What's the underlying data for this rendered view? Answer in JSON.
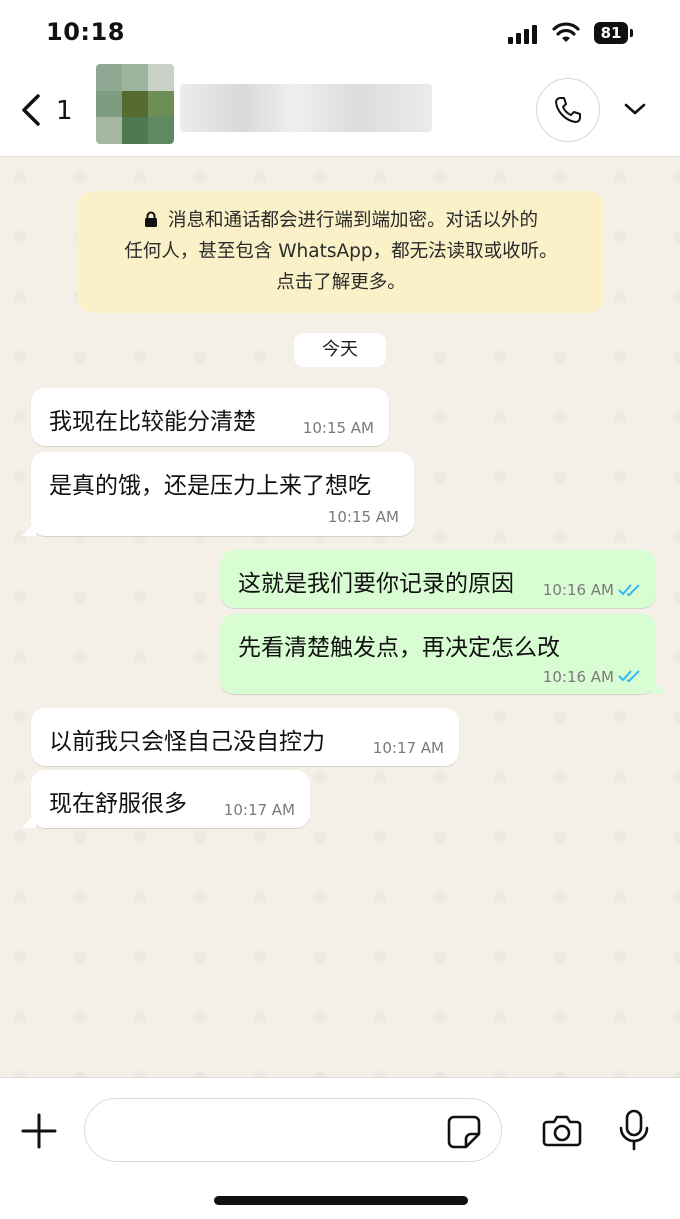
{
  "status_bar": {
    "time": "10:18",
    "battery": "81"
  },
  "header": {
    "back_count": "1"
  },
  "chat": {
    "encryption_notice": {
      "line1": "消息和通话都会进行端到端加密。对话以外的",
      "line2": "任何人，甚至包含 WhatsApp，都无法读取或收听。",
      "line3": "点击了解更多。"
    },
    "date_separator": "今天",
    "messages": [
      {
        "direction": "in",
        "text": "我现在比较能分清楚",
        "time": "10:15 AM"
      },
      {
        "direction": "in",
        "text": "是真的饿，还是压力上来了想吃",
        "time": "10:15 AM"
      },
      {
        "direction": "out",
        "text": "这就是我们要你记录的原因",
        "time": "10:16 AM",
        "status": "read"
      },
      {
        "direction": "out",
        "text": "先看清楚触发点，再决定怎么改",
        "time": "10:16 AM",
        "status": "read"
      },
      {
        "direction": "in",
        "text": "以前我只会怪自己没自控力",
        "time": "10:17 AM"
      },
      {
        "direction": "in",
        "text": "现在舒服很多",
        "time": "10:17 AM"
      }
    ]
  },
  "composer": {
    "input_value": ""
  },
  "colors": {
    "outgoing_bubble": "#d9fdd3",
    "incoming_bubble": "#ffffff",
    "read_ticks": "#34b7f1",
    "notice_bg": "#fbf1c8"
  },
  "icons": [
    "back-chevron-icon",
    "phone-icon",
    "chevron-down-icon",
    "lock-icon",
    "plus-icon",
    "sticker-icon",
    "camera-icon",
    "microphone-icon",
    "double-check-icon"
  ]
}
